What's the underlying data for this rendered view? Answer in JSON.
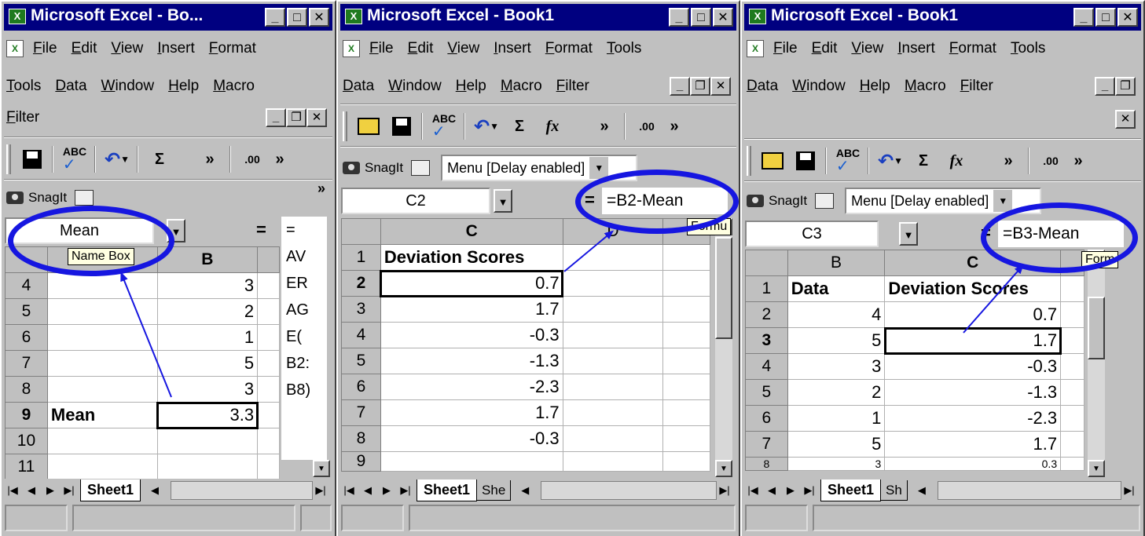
{
  "panels": [
    {
      "title": "Microsoft Excel - Bo...",
      "menu": {
        "row1": [
          "File",
          "Edit",
          "View",
          "Insert",
          "Format"
        ],
        "row2": [
          "Tools",
          "Data",
          "Window",
          "Help",
          "Macro"
        ],
        "row3": [
          "Filter"
        ]
      },
      "toolbar": {
        "sigma": "Σ",
        "decimals": ".00"
      },
      "snagit": "SnagIt",
      "name_box": "Mean",
      "tooltip": "Name Box",
      "formula_eq": "=",
      "formula_lines": [
        "=",
        "AV",
        "ER",
        "AG",
        "E(",
        "B2:",
        "B8)"
      ],
      "column_header": "B",
      "rows": [
        {
          "num": "4",
          "a": "",
          "b": "3"
        },
        {
          "num": "5",
          "a": "",
          "b": "2"
        },
        {
          "num": "6",
          "a": "",
          "b": "1"
        },
        {
          "num": "7",
          "a": "",
          "b": "5"
        },
        {
          "num": "8",
          "a": "",
          "b": "3"
        },
        {
          "num": "9",
          "a": "Mean",
          "b": "3.3"
        },
        {
          "num": "10",
          "a": "",
          "b": ""
        },
        {
          "num": "11",
          "a": "",
          "b": ""
        }
      ],
      "sheet_tab": "Sheet1"
    },
    {
      "title": "Microsoft Excel - Book1",
      "menu": {
        "row1": [
          "File",
          "Edit",
          "View",
          "Insert",
          "Format",
          "Tools"
        ],
        "row2": [
          "Data",
          "Window",
          "Help",
          "Macro",
          "Filter"
        ]
      },
      "toolbar": {
        "sigma": "Σ",
        "fx": "fx",
        "decimals": ".00"
      },
      "snagit": "SnagIt",
      "menu_combo": "Menu [Delay enabled]",
      "name_box": "C2",
      "formula_eq": "=",
      "formula": "=B2-Mean",
      "tooltip": "Formu",
      "column_headers": [
        "C",
        "D"
      ],
      "rows": [
        {
          "num": "1",
          "c": "Deviation Scores"
        },
        {
          "num": "2",
          "c": "0.7"
        },
        {
          "num": "3",
          "c": "1.7"
        },
        {
          "num": "4",
          "c": "-0.3"
        },
        {
          "num": "5",
          "c": "-1.3"
        },
        {
          "num": "6",
          "c": "-2.3"
        },
        {
          "num": "7",
          "c": "1.7"
        },
        {
          "num": "8",
          "c": "-0.3"
        },
        {
          "num": "9",
          "c": ""
        }
      ],
      "sheet_tab": "Sheet1",
      "sheet_tab2": "She"
    },
    {
      "title": "Microsoft Excel - Book1",
      "menu": {
        "row1": [
          "File",
          "Edit",
          "View",
          "Insert",
          "Format",
          "Tools"
        ],
        "row2": [
          "Data",
          "Window",
          "Help",
          "Macro",
          "Filter"
        ]
      },
      "toolbar": {
        "sigma": "Σ",
        "fx": "fx",
        "decimals": ".00"
      },
      "snagit": "SnagIt",
      "menu_combo": "Menu [Delay enabled]",
      "name_box": "C3",
      "formula_eq": "=",
      "formula": "=B3-Mean",
      "tooltip": "Form",
      "column_headers": [
        "B",
        "C"
      ],
      "rows": [
        {
          "num": "1",
          "b": "Data",
          "c": "Deviation Scores"
        },
        {
          "num": "2",
          "b": "4",
          "c": "0.7"
        },
        {
          "num": "3",
          "b": "5",
          "c": "1.7"
        },
        {
          "num": "4",
          "b": "3",
          "c": "-0.3"
        },
        {
          "num": "5",
          "b": "2",
          "c": "-1.3"
        },
        {
          "num": "6",
          "b": "1",
          "c": "-2.3"
        },
        {
          "num": "7",
          "b": "5",
          "c": "1.7"
        },
        {
          "num": "8",
          "b": "3",
          "c": "0.3"
        }
      ],
      "sheet_tab": "Sheet1",
      "sheet_tab2": "Sh"
    }
  ],
  "annotation_color": "#1616e0"
}
